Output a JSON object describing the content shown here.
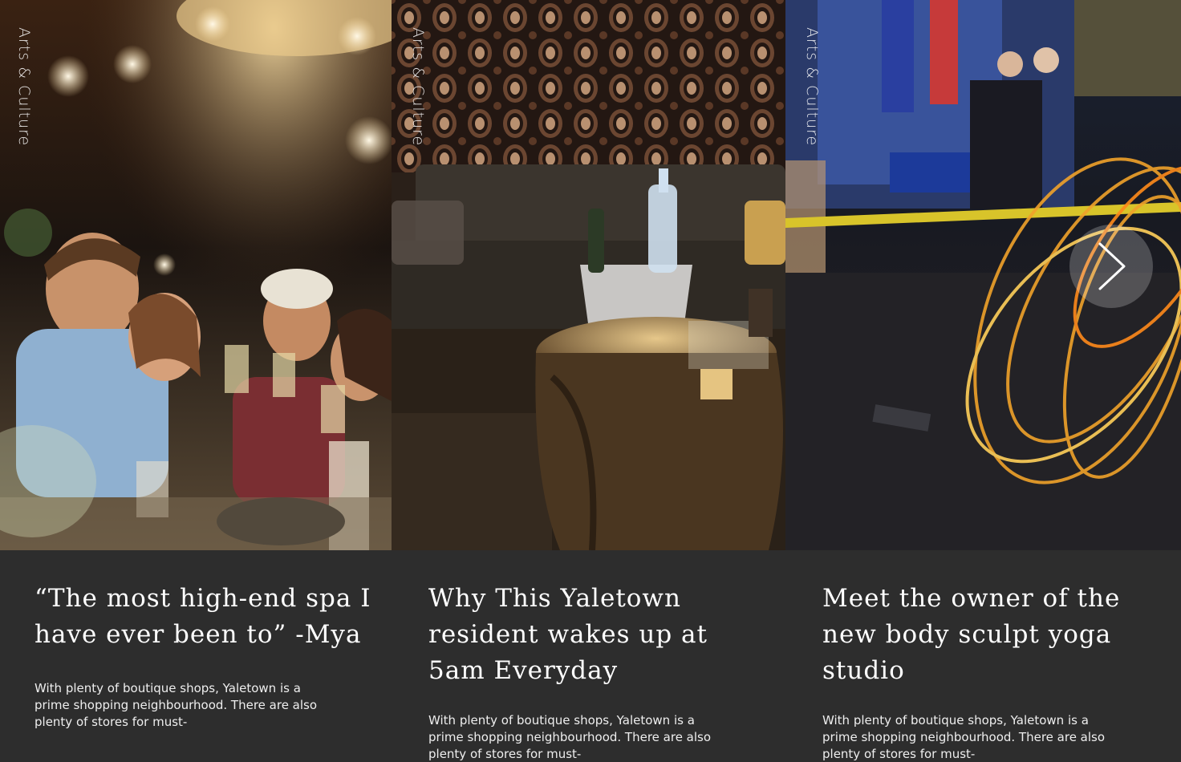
{
  "cards": [
    {
      "category": "Arts & Culture",
      "title": "“The most high-end spa I have ever been to” -Mya",
      "excerpt": "With plenty of boutique shops, Yaletown is a prime shopping neighbourhood. There are also plenty of stores for must-",
      "image": "friends-toasting-cocktails-photo"
    },
    {
      "category": "Arts & Culture",
      "title": "Why This Yaletown resident wakes up at 5am Everyday",
      "excerpt": "With plenty of boutique shops, Yaletown is a prime shopping neighbourhood. There are also plenty of stores for must-",
      "image": "lounge-champagne-bucket-photo"
    },
    {
      "category": "Arts & Culture",
      "title": "Meet the owner of the new body sculpt yoga studio",
      "excerpt": "With plenty of boutique shops, Yaletown is a prime shopping neighbourhood. There are also plenty of stores for must-",
      "image": "fire-dancer-street-photo"
    }
  ],
  "carousel": {
    "next_icon": "chevron-right-icon"
  },
  "colors": {
    "panel_background": "#2d2d2d",
    "text": "#ffffff"
  }
}
